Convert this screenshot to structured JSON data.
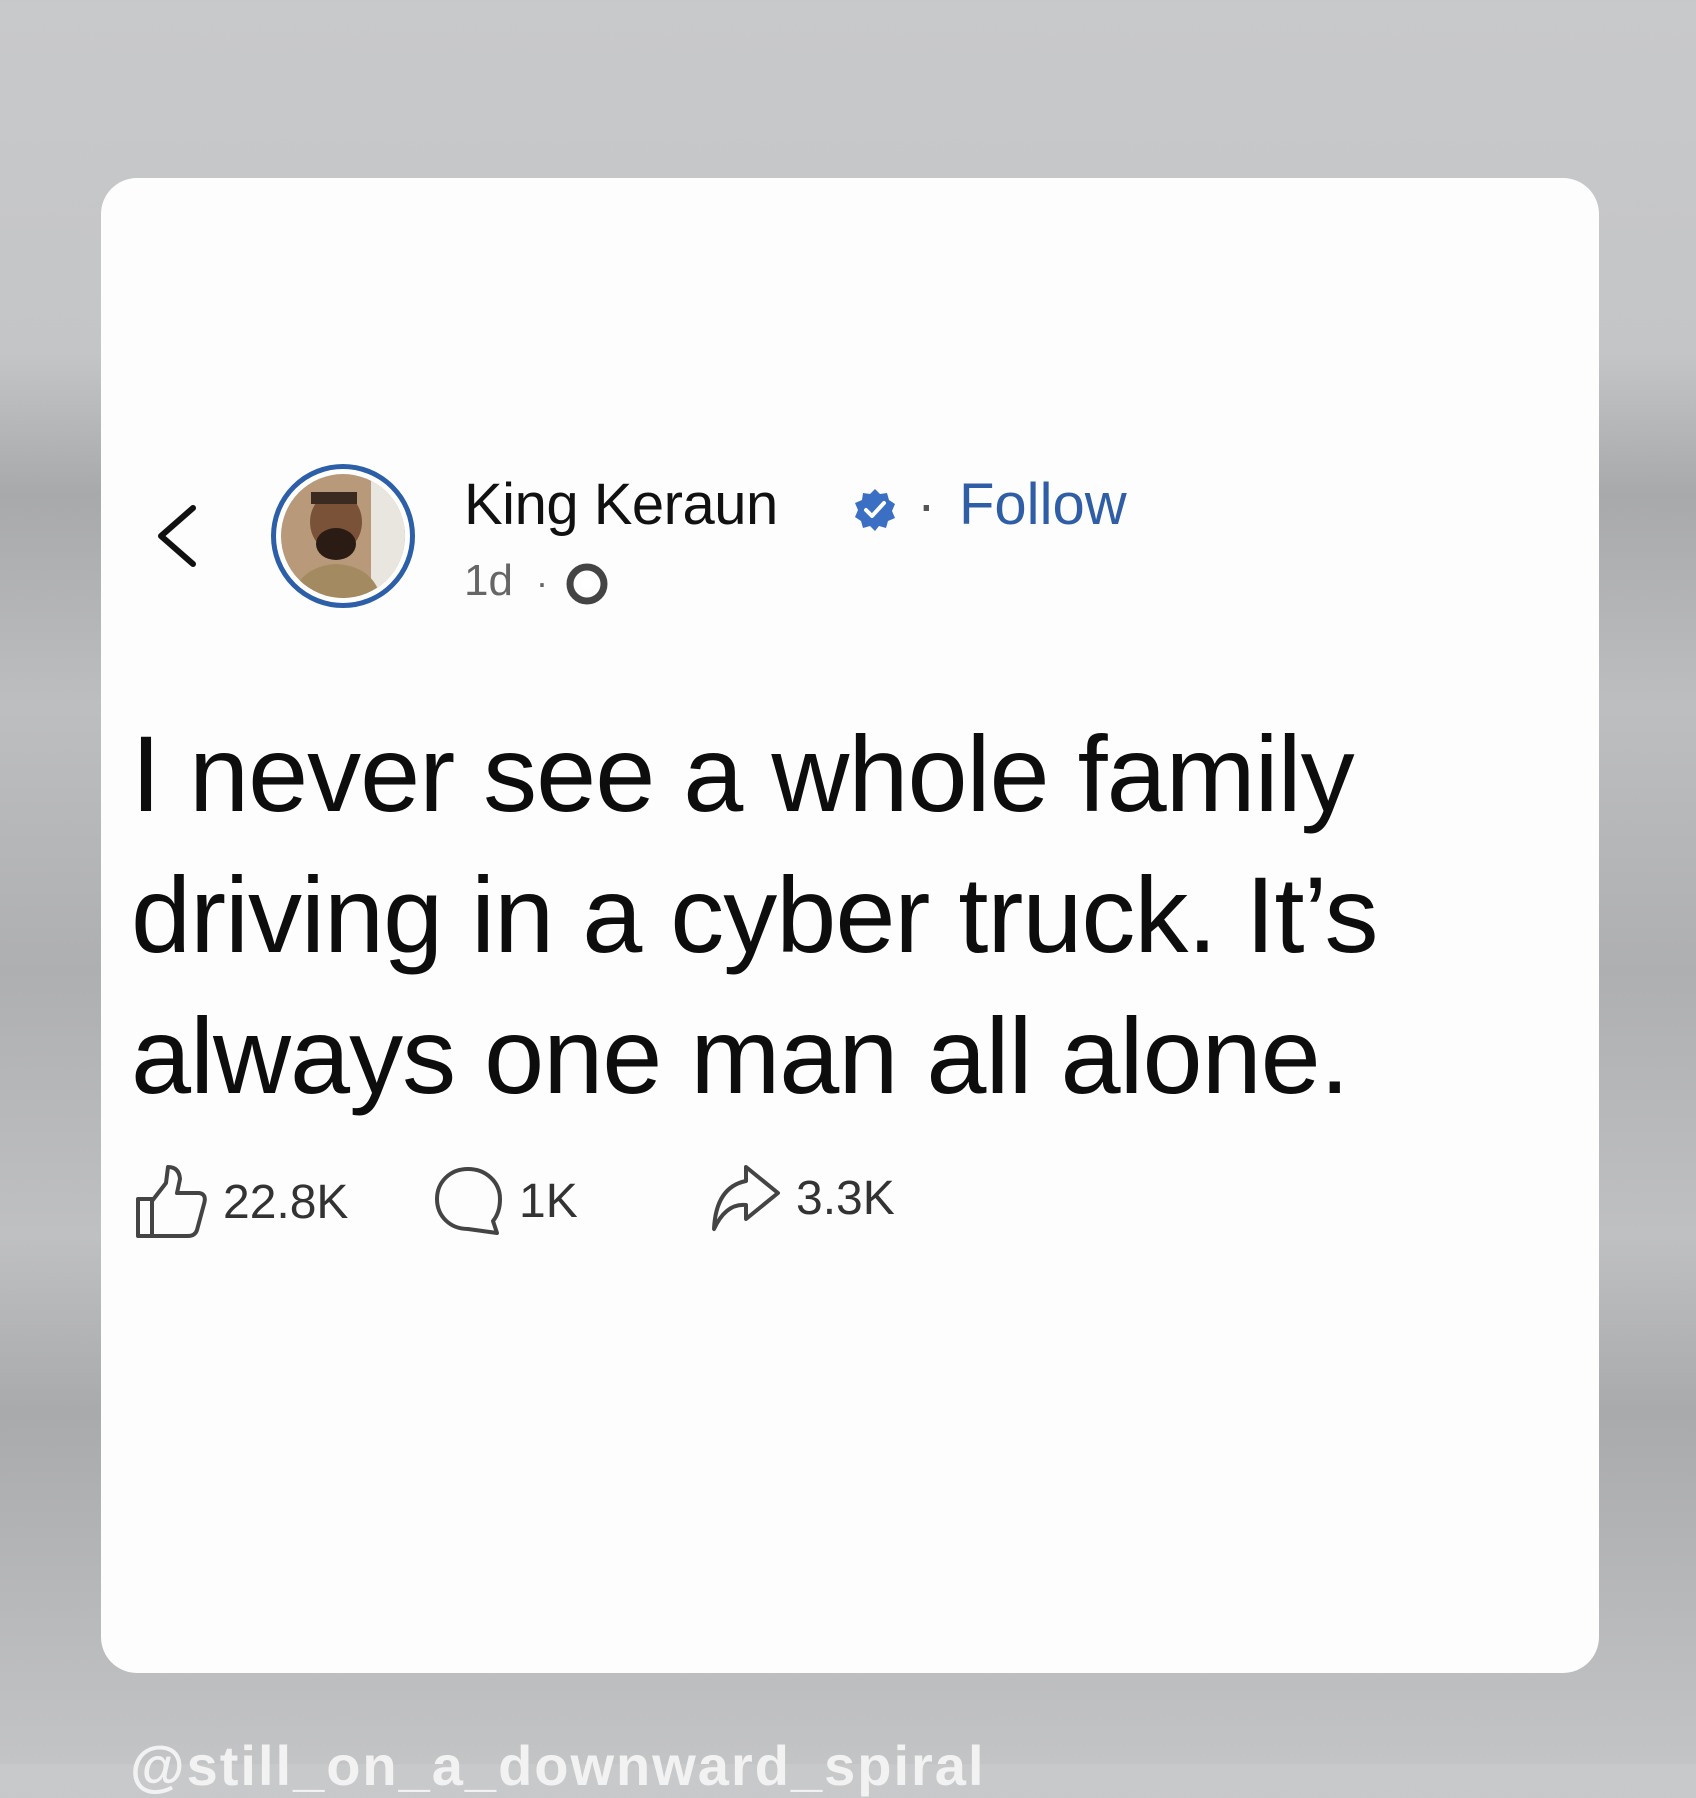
{
  "post": {
    "author": "King Keraun",
    "separator": "·",
    "follow_label": "Follow",
    "time": "1d",
    "meta_separator": "·",
    "text": "I never see a whole family driving in a cyber truck. It’s always one man all alone.",
    "likes": "22.8K",
    "comments": "1K",
    "shares": "3.3K"
  },
  "icons": {
    "back": "chevron-left-icon",
    "verified": "verified-badge-icon",
    "audience": "globe-icon",
    "like": "thumbs-up-icon",
    "comment": "comment-icon",
    "share": "share-icon"
  },
  "colors": {
    "accent": "#2f5ea6",
    "verified": "#3a6fc4",
    "text": "#0d0d0d",
    "card": "#fdfdfd"
  },
  "watermark": "@still_on_a_downward_spiral"
}
